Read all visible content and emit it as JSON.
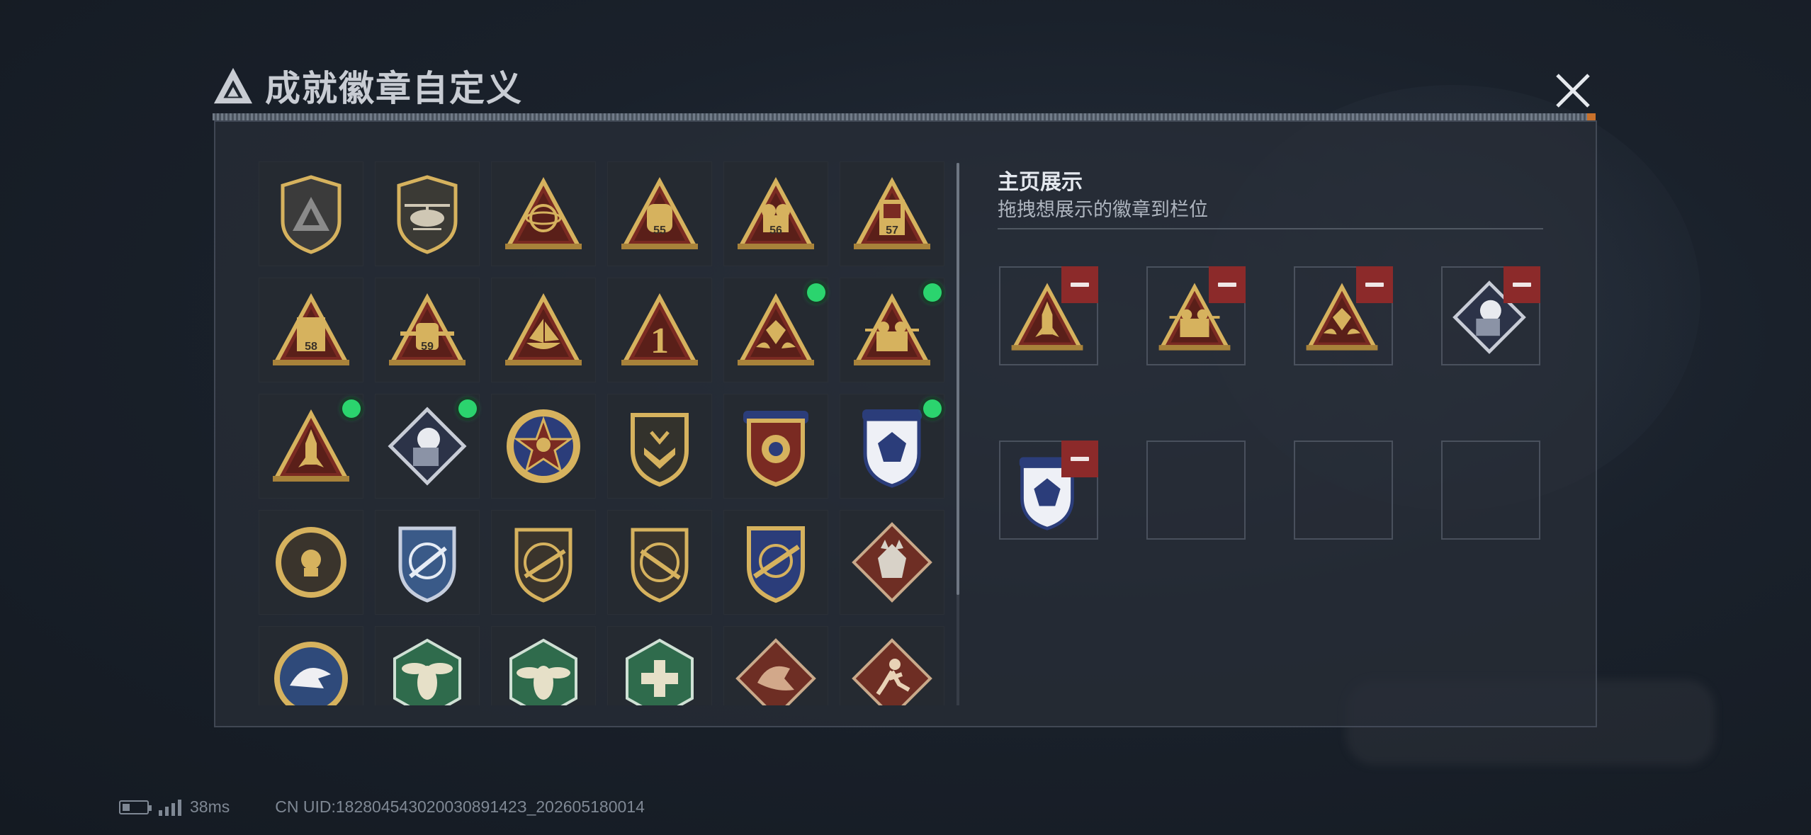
{
  "header": {
    "title": "成就徽章自定义",
    "close_icon": "close-icon"
  },
  "showcase": {
    "title": "主页展示",
    "subtitle": "拖拽想展示的徽章到栏位",
    "slots": [
      {
        "badge": "rocket-triangle-badge"
      },
      {
        "badge": "soldiers-triangle-badge"
      },
      {
        "badge": "hands-gem-triangle-badge"
      },
      {
        "badge": "silver-fist-diamond-badge"
      },
      {
        "badge": "blue-gem-shield-badge"
      },
      {
        "badge": null
      },
      {
        "badge": null
      },
      {
        "badge": null
      }
    ]
  },
  "grid": {
    "badges": [
      {
        "name": "delta-shield-badge",
        "new": false
      },
      {
        "name": "helicopter-shield-badge",
        "new": false
      },
      {
        "name": "armillary-triangle-badge",
        "new": false
      },
      {
        "name": "s5-triangle-badge",
        "new": false
      },
      {
        "name": "s6-triangle-badge",
        "new": false
      },
      {
        "name": "s7-triangle-badge",
        "new": false
      },
      {
        "name": "s8-triangle-badge",
        "new": false
      },
      {
        "name": "s9-triangle-badge",
        "new": false
      },
      {
        "name": "ship-triangle-badge",
        "new": false
      },
      {
        "name": "number-one-triangle-badge",
        "new": false
      },
      {
        "name": "hands-gem-triangle-badge",
        "new": true
      },
      {
        "name": "soldiers-triangle-badge",
        "new": true
      },
      {
        "name": "rocket-triangle-badge",
        "new": true
      },
      {
        "name": "silver-fist-diamond-badge",
        "new": true
      },
      {
        "name": "skull-star-badge",
        "new": false
      },
      {
        "name": "wings-chevron-shield-badge",
        "new": false
      },
      {
        "name": "gold-star-crest-badge",
        "new": false
      },
      {
        "name": "blue-gem-shield-badge",
        "new": true
      },
      {
        "name": "skull-target-badge",
        "new": false
      },
      {
        "name": "sniper-crosshair-shield-badge",
        "new": false
      },
      {
        "name": "rifle-shield-badge",
        "new": false
      },
      {
        "name": "rifle-circle-badge",
        "new": false
      },
      {
        "name": "rifle-crest-badge",
        "new": false
      },
      {
        "name": "wolf-diamond-badge",
        "new": false
      },
      {
        "name": "eagle-circle-badge",
        "new": false
      },
      {
        "name": "hornet-hexagon-badge",
        "new": false
      },
      {
        "name": "hornet-hexagon-2-badge",
        "new": false
      },
      {
        "name": "medic-hexagon-badge",
        "new": false
      },
      {
        "name": "dragon-diamond-badge",
        "new": false
      },
      {
        "name": "runner-diamond-badge",
        "new": false
      }
    ]
  },
  "footer": {
    "ping": "38ms",
    "uid": "CN UID:18280454302003089142З_202605180014"
  }
}
